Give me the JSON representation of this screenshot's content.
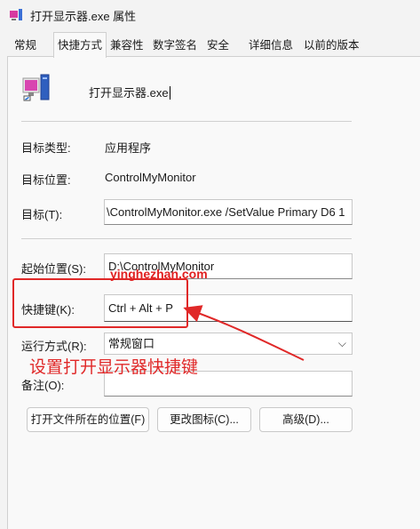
{
  "window": {
    "title": "打开显示器.exe 属性"
  },
  "tabs": [
    "常规",
    "快捷方式",
    "兼容性",
    "数字签名",
    "安全",
    "详细信息",
    "以前的版本"
  ],
  "header": {
    "app_name": "打开显示器.exe"
  },
  "rows": {
    "target_type_label": "目标类型:",
    "target_type_value": "应用程序",
    "target_location_label": "目标位置:",
    "target_location_value": "ControlMyMonitor",
    "target_label": "目标(T):",
    "target_value": "\\ControlMyMonitor.exe /SetValue Primary D6 1",
    "start_in_label": "起始位置(S):",
    "start_in_value": "D:\\ControlMyMonitor",
    "shortcut_key_label": "快捷键(K):",
    "shortcut_key_value": "Ctrl + Alt + P",
    "run_label": "运行方式(R):",
    "run_value": "常规窗口",
    "comment_label": "备注(O):",
    "comment_value": ""
  },
  "buttons": {
    "open_location": "打开文件所在的位置(F)",
    "change_icon": "更改图标(C)...",
    "advanced": "高级(D)..."
  },
  "overlay": {
    "watermark": "yinghezhan.com",
    "annotation": "设置打开显示器快捷键"
  },
  "colors": {
    "annotation": "#e02828"
  },
  "icons": {
    "app": "monitor-shortcut-icon",
    "dropdown": "chevron-down-icon"
  }
}
